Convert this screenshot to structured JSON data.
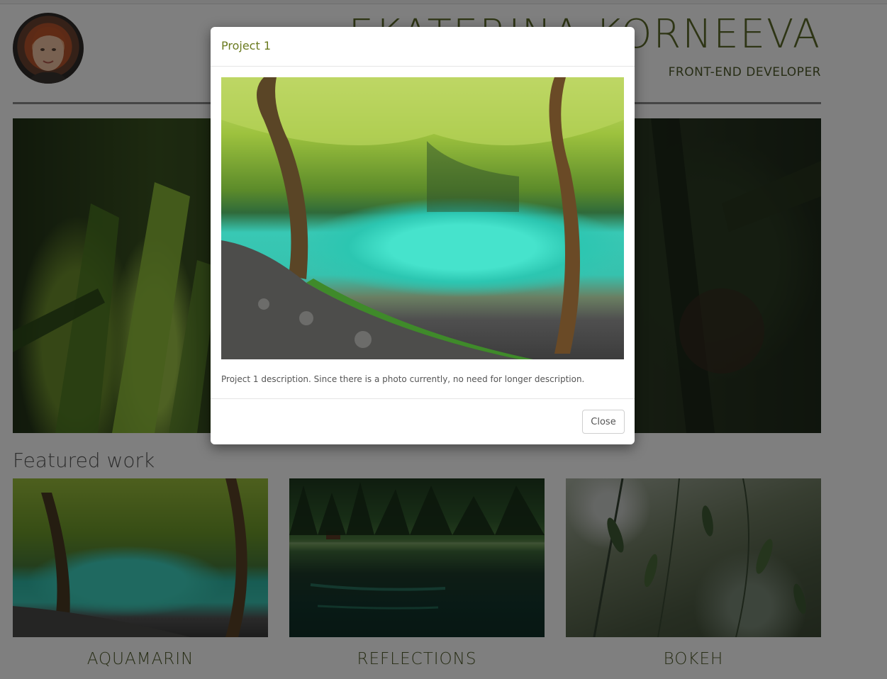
{
  "header": {
    "name": "EKATERINA KORNEEVA",
    "subtitle": "FRONT-END DEVELOPER"
  },
  "featured": {
    "title": "Featured work",
    "items": [
      {
        "label": "AQUAMARIN"
      },
      {
        "label": "REFLECTIONS"
      },
      {
        "label": "BOKEH"
      }
    ]
  },
  "modal": {
    "title": "Project 1",
    "description": "Project 1 description. Since there is a photo currently, no need for longer description.",
    "close_label": "Close"
  },
  "colors": {
    "accent": "#6a7a1f",
    "backdrop": "rgba(0,0,0,0.5)"
  }
}
